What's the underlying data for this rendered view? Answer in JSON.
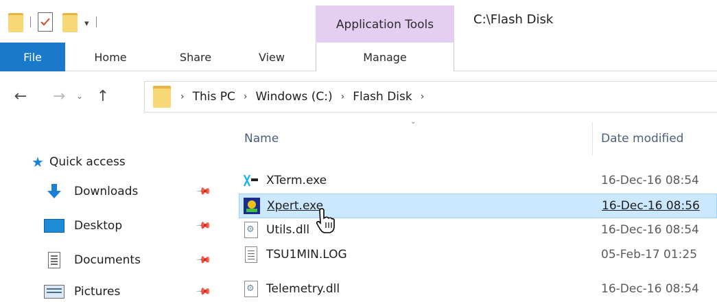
{
  "titlebar": {
    "context_group_title": "Application Tools",
    "window_title": "C:\\Flash Disk",
    "qat_dropdown_glyph": "▾"
  },
  "ribbon": {
    "tabs": [
      {
        "label": "File",
        "active_color": "#1979ca"
      },
      {
        "label": "Home"
      },
      {
        "label": "Share"
      },
      {
        "label": "View"
      },
      {
        "label": "Manage",
        "context_color": "#e4cff2"
      }
    ]
  },
  "navigation": {
    "back_icon": "←",
    "forward_icon": "→",
    "recent_icon": "⌄",
    "up_icon": "↑",
    "breadcrumbs": [
      "This PC",
      "Windows (C:)",
      "Flash Disk"
    ],
    "crumb_separator": "›"
  },
  "navpane": {
    "quick_access": "Quick access",
    "items": [
      {
        "label": "Downloads",
        "icon": "download-icon",
        "pinned": true
      },
      {
        "label": "Desktop",
        "icon": "desktop-icon",
        "pinned": true
      },
      {
        "label": "Documents",
        "icon": "documents-icon",
        "pinned": true
      },
      {
        "label": "Pictures",
        "icon": "pictures-icon",
        "pinned": true
      }
    ]
  },
  "filelist": {
    "columns": {
      "name": "Name",
      "date_modified": "Date modified"
    },
    "sort_indicator": "⌄",
    "files": [
      {
        "name": "XTerm.exe",
        "date": "16-Dec-16 08:54",
        "icon": "xterm-app-icon"
      },
      {
        "name": "Xpert.exe",
        "date": "16-Dec-16 08:56",
        "icon": "xpert-app-icon",
        "selected": true
      },
      {
        "name": "Utils.dll",
        "date": "16-Dec-16 08:54",
        "icon": "dll-file-icon"
      },
      {
        "name": "TSU1MIN.LOG",
        "date": "05-Feb-17 01:25",
        "icon": "log-file-icon"
      },
      {
        "name": "Telemetry.dll",
        "date": "16-Dec-16 08:54",
        "icon": "dll-file-icon"
      }
    ]
  }
}
